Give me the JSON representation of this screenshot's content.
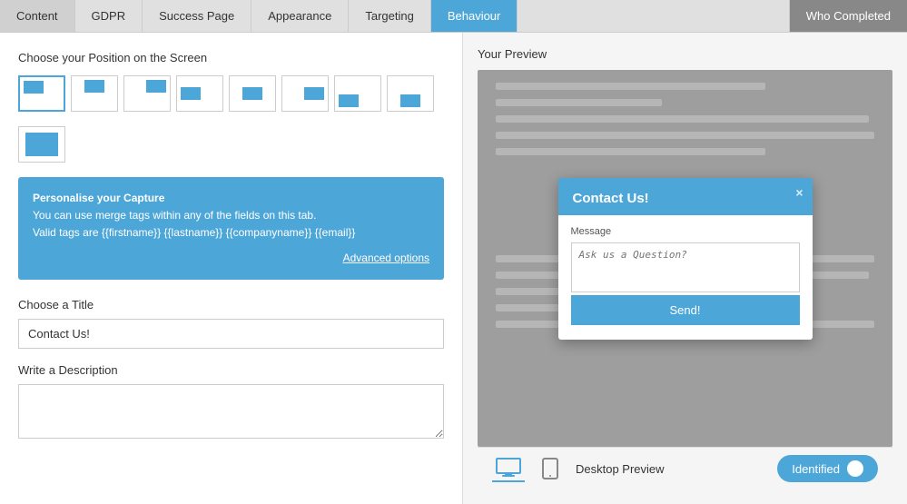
{
  "tabs": [
    {
      "id": "content",
      "label": "Content",
      "active": false
    },
    {
      "id": "gdpr",
      "label": "GDPR",
      "active": false
    },
    {
      "id": "success-page",
      "label": "Success Page",
      "active": false
    },
    {
      "id": "appearance",
      "label": "Appearance",
      "active": false
    },
    {
      "id": "targeting",
      "label": "Targeting",
      "active": false
    },
    {
      "id": "behaviour",
      "label": "Behaviour",
      "active": true
    }
  ],
  "who_completed_tab": "Who Completed",
  "left": {
    "position_section_title": "Choose your Position on the Screen",
    "info_box": {
      "line1": "Personalise your Capture",
      "line2": "You can use merge tags within any of the fields on this tab.",
      "line3": "Valid tags are {{firstname}} {{lastname}} {{companyname}} {{email}}",
      "advanced_link": "Advanced options"
    },
    "title_label": "Choose a Title",
    "title_value": "Contact Us!",
    "description_label": "Write a Description",
    "description_placeholder": ""
  },
  "preview": {
    "title": "Your Preview",
    "popup": {
      "title": "Contact Us!",
      "close": "×",
      "field_label": "Message",
      "placeholder": "Ask us a Question?",
      "send_button": "Send!"
    }
  },
  "bottom_bar": {
    "device_label": "Desktop Preview",
    "toggle_label": "Identified"
  },
  "icons": {
    "desktop": "🖥",
    "tablet": "📱"
  }
}
